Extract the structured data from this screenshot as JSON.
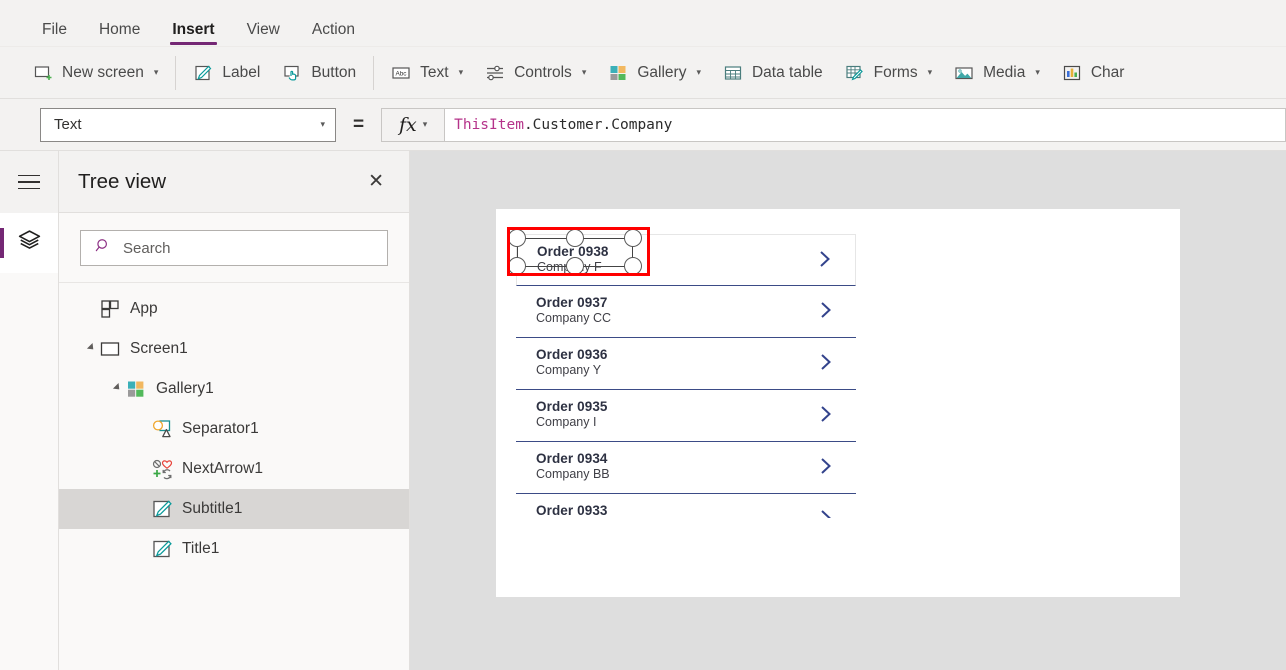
{
  "menubar": {
    "items": [
      {
        "label": "File",
        "active": false
      },
      {
        "label": "Home",
        "active": false
      },
      {
        "label": "Insert",
        "active": true
      },
      {
        "label": "View",
        "active": false
      },
      {
        "label": "Action",
        "active": false
      }
    ],
    "accent_color": "#742774"
  },
  "ribbon": {
    "items": [
      {
        "label": "New screen",
        "icon": "new-screen-icon",
        "caret": true
      },
      {
        "label": "Label",
        "icon": "label-icon",
        "caret": false
      },
      {
        "label": "Button",
        "icon": "button-icon",
        "caret": false
      },
      {
        "label": "Text",
        "icon": "text-icon",
        "caret": true
      },
      {
        "label": "Controls",
        "icon": "controls-icon",
        "caret": true
      },
      {
        "label": "Gallery",
        "icon": "gallery-icon",
        "caret": true
      },
      {
        "label": "Data table",
        "icon": "data-table-icon",
        "caret": false
      },
      {
        "label": "Forms",
        "icon": "forms-icon",
        "caret": true
      },
      {
        "label": "Media",
        "icon": "media-icon",
        "caret": true
      },
      {
        "label": "Char",
        "icon": "charts-icon",
        "caret": false
      }
    ]
  },
  "formula_bar": {
    "property_value": "Text",
    "equals": "=",
    "fx_label": "fx",
    "formula_token_identifier": "ThisItem",
    "formula_token_rest": ".Customer.Company",
    "formula_full": "ThisItem.Customer.Company",
    "identifier_color": "#b5338a"
  },
  "rail": {
    "menu_icon": "hamburger-icon",
    "active_icon": "tree-view-layers-icon"
  },
  "tree_panel": {
    "title": "Tree view",
    "close_label": "✕",
    "search_placeholder": "Search",
    "search_value": "",
    "items": [
      {
        "label": "App",
        "icon": "app-icon",
        "depth": 0,
        "twisty": "none",
        "selected": false
      },
      {
        "label": "Screen1",
        "icon": "screen-icon",
        "depth": 0,
        "twisty": "expanded",
        "selected": false
      },
      {
        "label": "Gallery1",
        "icon": "gallery-icon",
        "depth": 1,
        "twisty": "expanded",
        "selected": false
      },
      {
        "label": "Separator1",
        "icon": "shapes-icon",
        "depth": 2,
        "twisty": "none",
        "selected": false
      },
      {
        "label": "NextArrow1",
        "icon": "icons-icon",
        "depth": 2,
        "twisty": "none",
        "selected": false
      },
      {
        "label": "Subtitle1",
        "icon": "label-icon",
        "depth": 2,
        "twisty": "none",
        "selected": true
      },
      {
        "label": "Title1",
        "icon": "label-icon",
        "depth": 2,
        "twisty": "none",
        "selected": false
      }
    ]
  },
  "canvas": {
    "background_color": "#dedede",
    "screen_background": "#ffffff",
    "selection_color": "#ff0000",
    "gallery": {
      "rows": [
        {
          "title": "Order 0938",
          "subtitle": "Company F",
          "selected": true,
          "clipped": false
        },
        {
          "title": "Order 0937",
          "subtitle": "Company CC",
          "selected": false,
          "clipped": false
        },
        {
          "title": "Order 0936",
          "subtitle": "Company Y",
          "selected": false,
          "clipped": false
        },
        {
          "title": "Order 0935",
          "subtitle": "Company I",
          "selected": false,
          "clipped": false
        },
        {
          "title": "Order 0934",
          "subtitle": "Company BB",
          "selected": false,
          "clipped": false
        },
        {
          "title": "Order 0933",
          "subtitle": "",
          "selected": false,
          "clipped": true
        }
      ]
    }
  }
}
